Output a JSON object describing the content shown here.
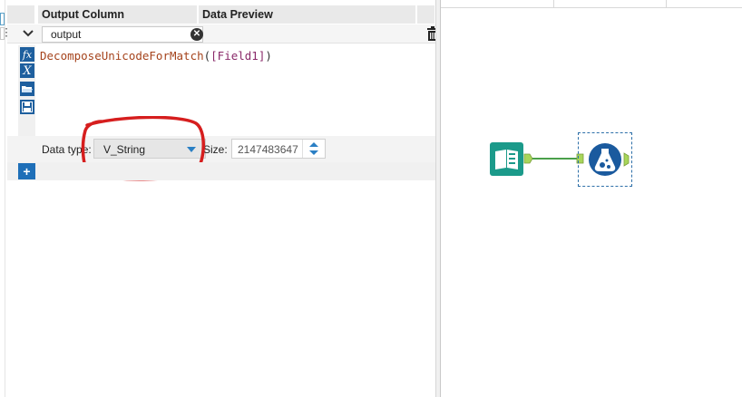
{
  "headers": {
    "output_column": "Output Column",
    "data_preview": "Data Preview"
  },
  "field": {
    "output_value": "output"
  },
  "expression": {
    "function": "DecomposeUnicodeForMatch",
    "open": "(",
    "field": "[Field1]",
    "close": ")"
  },
  "data_type": {
    "label": "Data type:",
    "selected": "V_String"
  },
  "size": {
    "label": "Size:",
    "value": "2147483647"
  },
  "tool_icons": [
    "function-fx-icon",
    "variable-x-icon",
    "open-folder-icon",
    "save-disk-icon"
  ],
  "colors": {
    "accent": "#1e5f9e",
    "annotation": "#d61e1e",
    "connector": "#4aa04a",
    "input_tool": "#1b9a8a",
    "formula_tool": "#1a5a9e",
    "anchor": "#a8d65a"
  }
}
